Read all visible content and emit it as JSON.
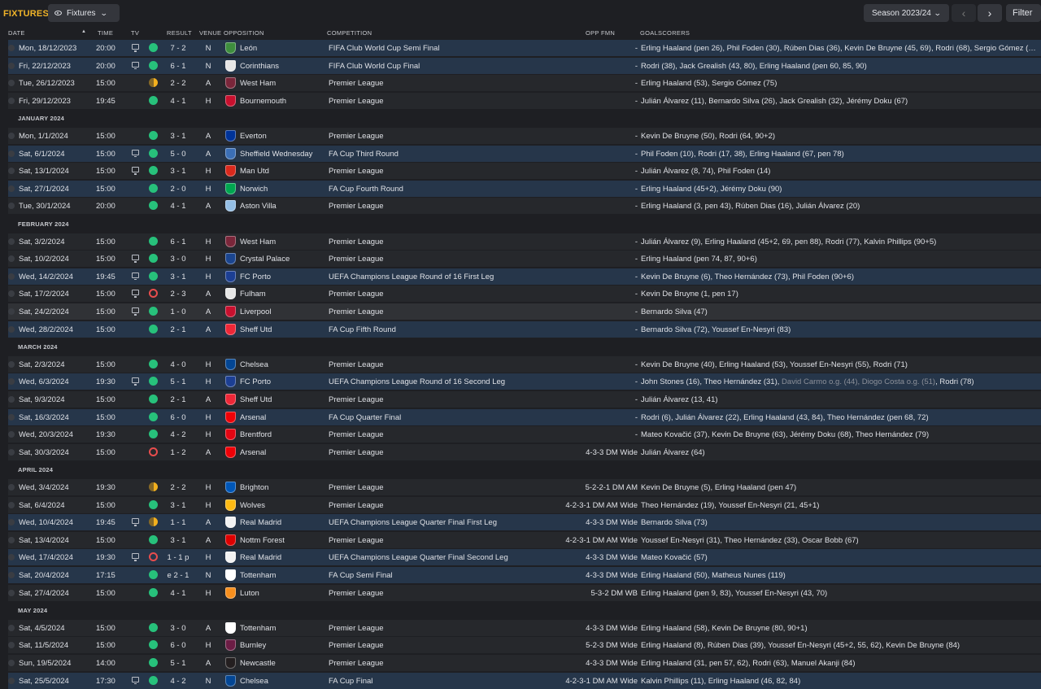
{
  "header": {
    "title": "FIXTURES",
    "view_label": "Fixtures",
    "season_label": "Season 2023/24",
    "filter_label": "Filter"
  },
  "columns": {
    "date": "DATE",
    "time": "TIME",
    "tv": "TV",
    "result": "RESULT",
    "venue": "VENUE",
    "opposition": "OPPOSITION",
    "competition": "COMPETITION",
    "opp_fmn": "OPP FMN",
    "goalscorers": "GOALSCORERS"
  },
  "colors": {
    "accent": "#f0b429",
    "win": "#27c17b",
    "draw": "#f2b01e",
    "loss": "#e84d4d",
    "highlight_row": "#26364a"
  },
  "rows": [
    {
      "kind": "match",
      "hl": true,
      "date": "Mon, 18/12/2023",
      "time": "20:00",
      "tv": true,
      "res": "win",
      "score": "7 - 2",
      "venue": "N",
      "opp": "León",
      "crest": "#3e8e3e",
      "comp": "FIFA Club World Cup Semi Final",
      "fmn": "-",
      "goals": "Erling Haaland (pen 26), Phil Foden (30), Rúben Dias (36), Kevin De Bruyne (45, 69), Rodri (68), Sergio Gómez (…"
    },
    {
      "kind": "match",
      "hl": true,
      "date": "Fri, 22/12/2023",
      "time": "20:00",
      "tv": true,
      "res": "win",
      "score": "6 - 1",
      "venue": "N",
      "opp": "Corinthians",
      "crest": "#e6e6e6",
      "comp": "FIFA Club World Cup Final",
      "fmn": "-",
      "goals": "Rodri (38), Jack Grealish (43, 80), Erling Haaland (pen 60, 85, 90)"
    },
    {
      "kind": "match",
      "hl": false,
      "date": "Tue, 26/12/2023",
      "time": "15:00",
      "tv": false,
      "res": "draw",
      "score": "2 - 2",
      "venue": "A",
      "opp": "West Ham",
      "crest": "#7a263a",
      "comp": "Premier League",
      "fmn": "-",
      "goals": "Erling Haaland (53), Sergio Gómez (75)"
    },
    {
      "kind": "match",
      "hl": false,
      "date": "Fri, 29/12/2023",
      "time": "19:45",
      "tv": false,
      "res": "win",
      "score": "4 - 1",
      "venue": "H",
      "opp": "Bournemouth",
      "crest": "#c8102e",
      "comp": "Premier League",
      "fmn": "-",
      "goals": "Julián Álvarez (11), Bernardo Silva (26), Jack Grealish (32), Jérémy Doku (67)"
    },
    {
      "kind": "month",
      "label": "JANUARY 2024"
    },
    {
      "kind": "match",
      "hl": false,
      "date": "Mon, 1/1/2024",
      "time": "15:00",
      "tv": false,
      "res": "win",
      "score": "3 - 1",
      "venue": "A",
      "opp": "Everton",
      "crest": "#003399",
      "comp": "Premier League",
      "fmn": "-",
      "goals": "Kevin De Bruyne (50), Rodri (64, 90+2)"
    },
    {
      "kind": "match",
      "hl": true,
      "date": "Sat, 6/1/2024",
      "time": "15:00",
      "tv": true,
      "res": "win",
      "score": "5 - 0",
      "venue": "A",
      "opp": "Sheffield Wednesday",
      "crest": "#3b6fb6",
      "comp": "FA Cup Third Round",
      "fmn": "-",
      "goals": "Phil Foden (10), Rodri (17, 38), Erling Haaland (67, pen 78)"
    },
    {
      "kind": "match",
      "hl": false,
      "date": "Sat, 13/1/2024",
      "time": "15:00",
      "tv": true,
      "res": "win",
      "score": "3 - 1",
      "venue": "H",
      "opp": "Man Utd",
      "crest": "#da291c",
      "comp": "Premier League",
      "fmn": "-",
      "goals": "Julián Álvarez (8, 74), Phil Foden (14)"
    },
    {
      "kind": "match",
      "hl": true,
      "date": "Sat, 27/1/2024",
      "time": "15:00",
      "tv": false,
      "res": "win",
      "score": "2 - 0",
      "venue": "H",
      "opp": "Norwich",
      "crest": "#00a650",
      "comp": "FA Cup Fourth Round",
      "fmn": "-",
      "goals": "Erling Haaland (45+2), Jérémy Doku (90)"
    },
    {
      "kind": "match",
      "hl": false,
      "date": "Tue, 30/1/2024",
      "time": "20:00",
      "tv": false,
      "res": "win",
      "score": "4 - 1",
      "venue": "A",
      "opp": "Aston Villa",
      "crest": "#95bfe5",
      "comp": "Premier League",
      "fmn": "-",
      "goals": "Erling Haaland (3, pen 43), Rúben Dias (16), Julián Álvarez (20)"
    },
    {
      "kind": "month",
      "label": "FEBRUARY 2024"
    },
    {
      "kind": "match",
      "hl": false,
      "date": "Sat, 3/2/2024",
      "time": "15:00",
      "tv": false,
      "res": "win",
      "score": "6 - 1",
      "venue": "H",
      "opp": "West Ham",
      "crest": "#7a263a",
      "comp": "Premier League",
      "fmn": "-",
      "goals": "Julián Álvarez (9), Erling Haaland (45+2, 69, pen 88), Rodri (77), Kalvin Phillips (90+5)"
    },
    {
      "kind": "match",
      "hl": false,
      "date": "Sat, 10/2/2024",
      "time": "15:00",
      "tv": true,
      "res": "win",
      "score": "3 - 0",
      "venue": "H",
      "opp": "Crystal Palace",
      "crest": "#1b458f",
      "comp": "Premier League",
      "fmn": "-",
      "goals": "Erling Haaland (pen 74, 87, 90+6)"
    },
    {
      "kind": "match",
      "hl": true,
      "date": "Wed, 14/2/2024",
      "time": "19:45",
      "tv": true,
      "res": "win",
      "score": "3 - 1",
      "venue": "H",
      "opp": "FC Porto",
      "crest": "#1c3f94",
      "comp": "UEFA Champions League Round of 16 First Leg",
      "fmn": "-",
      "goals": "Kevin De Bruyne (6), Theo Hernández (73), Phil Foden (90+6)"
    },
    {
      "kind": "match",
      "hl": false,
      "date": "Sat, 17/2/2024",
      "time": "15:00",
      "tv": true,
      "res": "loss",
      "score": "2 - 3",
      "venue": "A",
      "opp": "Fulham",
      "crest": "#e6e6e6",
      "comp": "Premier League",
      "fmn": "-",
      "goals": "Kevin De Bruyne (1, pen 17)"
    },
    {
      "kind": "match",
      "hl": false,
      "sel": true,
      "date": "Sat, 24/2/2024",
      "time": "15:00",
      "tv": true,
      "res": "win",
      "score": "1 - 0",
      "venue": "A",
      "opp": "Liverpool",
      "crest": "#c8102e",
      "comp": "Premier League",
      "fmn": "-",
      "goals": "Bernardo Silva (47)"
    },
    {
      "kind": "match",
      "hl": true,
      "date": "Wed, 28/2/2024",
      "time": "15:00",
      "tv": false,
      "res": "win",
      "score": "2 - 1",
      "venue": "A",
      "opp": "Sheff Utd",
      "crest": "#ee2737",
      "comp": "FA Cup Fifth Round",
      "fmn": "-",
      "goals": "Bernardo Silva (72), Youssef En-Nesyri (83)"
    },
    {
      "kind": "month",
      "label": "MARCH 2024"
    },
    {
      "kind": "match",
      "hl": false,
      "date": "Sat, 2/3/2024",
      "time": "15:00",
      "tv": false,
      "res": "win",
      "score": "4 - 0",
      "venue": "H",
      "opp": "Chelsea",
      "crest": "#034694",
      "comp": "Premier League",
      "fmn": "-",
      "goals": "Kevin De Bruyne (40), Erling Haaland (53), Youssef En-Nesyri (55), Rodri (71)"
    },
    {
      "kind": "match",
      "hl": true,
      "date": "Wed, 6/3/2024",
      "time": "19:30",
      "tv": true,
      "res": "win",
      "score": "5 - 1",
      "venue": "H",
      "opp": "FC Porto",
      "crest": "#1c3f94",
      "comp": "UEFA Champions League Round of 16 Second Leg",
      "fmn": "-",
      "goals_parts": [
        {
          "t": "John Stones (16), Theo Hernández (31), "
        },
        {
          "t": "David Carmo o.g. (44), Diogo Costa o.g. (51)",
          "og": true
        },
        {
          "t": ", Rodri (78)"
        }
      ]
    },
    {
      "kind": "match",
      "hl": false,
      "date": "Sat, 9/3/2024",
      "time": "15:00",
      "tv": false,
      "res": "win",
      "score": "2 - 1",
      "venue": "A",
      "opp": "Sheff Utd",
      "crest": "#ee2737",
      "comp": "Premier League",
      "fmn": "-",
      "goals": "Julián Álvarez (13, 41)"
    },
    {
      "kind": "match",
      "hl": true,
      "date": "Sat, 16/3/2024",
      "time": "15:00",
      "tv": false,
      "res": "win",
      "score": "6 - 0",
      "venue": "H",
      "opp": "Arsenal",
      "crest": "#ef0107",
      "comp": "FA Cup Quarter Final",
      "fmn": "-",
      "goals": "Rodri (6), Julián Álvarez (22), Erling Haaland (43, 84), Theo Hernández (pen 68, 72)"
    },
    {
      "kind": "match",
      "hl": false,
      "date": "Wed, 20/3/2024",
      "time": "19:30",
      "tv": false,
      "res": "win",
      "score": "4 - 2",
      "venue": "H",
      "opp": "Brentford",
      "crest": "#e30613",
      "comp": "Premier League",
      "fmn": "-",
      "goals": "Mateo Kovačić (37), Kevin De Bruyne (63), Jérémy Doku (68), Theo Hernández (79)"
    },
    {
      "kind": "match",
      "hl": false,
      "date": "Sat, 30/3/2024",
      "time": "15:00",
      "tv": false,
      "res": "loss",
      "score": "1 - 2",
      "venue": "A",
      "opp": "Arsenal",
      "crest": "#ef0107",
      "comp": "Premier League",
      "fmn": "4-3-3 DM Wide",
      "goals": "Julián Álvarez (64)"
    },
    {
      "kind": "month",
      "label": "APRIL 2024"
    },
    {
      "kind": "match",
      "hl": false,
      "date": "Wed, 3/4/2024",
      "time": "19:30",
      "tv": false,
      "res": "draw",
      "score": "2 - 2",
      "venue": "H",
      "opp": "Brighton",
      "crest": "#0057b8",
      "comp": "Premier League",
      "fmn": "5-2-2-1 DM AM",
      "goals": "Kevin De Bruyne (5), Erling Haaland (pen 47)"
    },
    {
      "kind": "match",
      "hl": false,
      "date": "Sat, 6/4/2024",
      "time": "15:00",
      "tv": false,
      "res": "win",
      "score": "3 - 1",
      "venue": "H",
      "opp": "Wolves",
      "crest": "#fdb913",
      "comp": "Premier League",
      "fmn": "4-2-3-1 DM AM Wide",
      "goals": "Theo Hernández (19), Youssef En-Nesyri (21, 45+1)"
    },
    {
      "kind": "match",
      "hl": true,
      "date": "Wed, 10/4/2024",
      "time": "19:45",
      "tv": true,
      "res": "draw",
      "score": "1 - 1",
      "venue": "A",
      "opp": "Real Madrid",
      "crest": "#f2f2f2",
      "comp": "UEFA Champions League Quarter Final First Leg",
      "fmn": "4-3-3 DM Wide",
      "goals": "Bernardo Silva (73)"
    },
    {
      "kind": "match",
      "hl": false,
      "date": "Sat, 13/4/2024",
      "time": "15:00",
      "tv": false,
      "res": "win",
      "score": "3 - 1",
      "venue": "A",
      "opp": "Nottm Forest",
      "crest": "#dd0000",
      "comp": "Premier League",
      "fmn": "4-2-3-1 DM AM Wide",
      "goals": "Youssef En-Nesyri (31), Theo Hernández (33), Oscar Bobb (67)"
    },
    {
      "kind": "match",
      "hl": true,
      "date": "Wed, 17/4/2024",
      "time": "19:30",
      "tv": true,
      "res": "loss",
      "score": "1 - 1 p",
      "venue": "H",
      "opp": "Real Madrid",
      "crest": "#f2f2f2",
      "comp": "UEFA Champions League Quarter Final Second Leg",
      "fmn": "4-3-3 DM Wide",
      "goals": "Mateo Kovačić (57)"
    },
    {
      "kind": "match",
      "hl": true,
      "date": "Sat, 20/4/2024",
      "time": "17:15",
      "tv": false,
      "res": "win",
      "score": "e 2 - 1",
      "venue": "N",
      "opp": "Tottenham",
      "crest": "#ffffff",
      "comp": "FA Cup Semi Final",
      "fmn": "4-3-3 DM Wide",
      "goals": "Erling Haaland (50), Matheus Nunes (119)"
    },
    {
      "kind": "match",
      "hl": false,
      "date": "Sat, 27/4/2024",
      "time": "15:00",
      "tv": false,
      "res": "win",
      "score": "4 - 1",
      "venue": "H",
      "opp": "Luton",
      "crest": "#f78f1e",
      "comp": "Premier League",
      "fmn": "5-3-2 DM WB",
      "goals": "Erling Haaland (pen 9, 83), Youssef En-Nesyri (43, 70)"
    },
    {
      "kind": "month",
      "label": "MAY 2024"
    },
    {
      "kind": "match",
      "hl": false,
      "date": "Sat, 4/5/2024",
      "time": "15:00",
      "tv": false,
      "res": "win",
      "score": "3 - 0",
      "venue": "A",
      "opp": "Tottenham",
      "crest": "#ffffff",
      "comp": "Premier League",
      "fmn": "4-3-3 DM Wide",
      "goals": "Erling Haaland (58), Kevin De Bruyne (80, 90+1)"
    },
    {
      "kind": "match",
      "hl": false,
      "date": "Sat, 11/5/2024",
      "time": "15:00",
      "tv": false,
      "res": "win",
      "score": "6 - 0",
      "venue": "H",
      "opp": "Burnley",
      "crest": "#6c1d45",
      "comp": "Premier League",
      "fmn": "5-2-3 DM Wide",
      "goals": "Erling Haaland (8), Rúben Dias (39), Youssef En-Nesyri (45+2, 55, 62), Kevin De Bruyne (84)"
    },
    {
      "kind": "match",
      "hl": false,
      "date": "Sun, 19/5/2024",
      "time": "14:00",
      "tv": false,
      "res": "win",
      "score": "5 - 1",
      "venue": "A",
      "opp": "Newcastle",
      "crest": "#241f20",
      "comp": "Premier League",
      "fmn": "4-3-3 DM Wide",
      "goals": "Erling Haaland (31, pen 57, 62), Rodri (63), Manuel Akanji (84)"
    },
    {
      "kind": "match",
      "hl": true,
      "date": "Sat, 25/5/2024",
      "time": "17:30",
      "tv": true,
      "res": "win",
      "score": "4 - 2",
      "venue": "N",
      "opp": "Chelsea",
      "crest": "#034694",
      "comp": "FA Cup Final",
      "fmn": "4-2-3-1 DM AM Wide",
      "goals": "Kalvin Phillips (11), Erling Haaland (46, 82, 84)"
    }
  ]
}
